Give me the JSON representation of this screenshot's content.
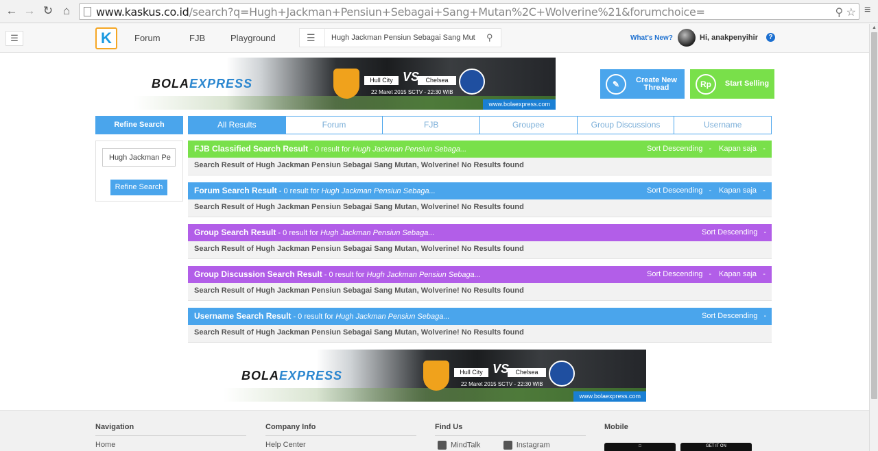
{
  "browser": {
    "url_host": "www.kaskus.co.id",
    "url_path": "/search?q=Hugh+Jackman+Pensiun+Sebagai+Sang+Mutan%2C+Wolverine%21&forumchoice="
  },
  "header": {
    "nav": [
      "Forum",
      "FJB",
      "Playground"
    ],
    "search_value": "Hugh Jackman Pensiun Sebagai Sang Mutan",
    "whats_new": "What's New?",
    "greeting": "Hi, anakpenyihir"
  },
  "banner": {
    "brand_1": "BOLA",
    "brand_2": "EXPRESS",
    "team_home": "Hull City",
    "team_away": "Chelsea",
    "vs": "VS",
    "date": "22 Maret 2015 SCTV - 22:30 WIB",
    "site": "www.bolaexpress.com"
  },
  "actions": {
    "create": "Create New Thread",
    "sell": "Start Selling",
    "sell_icon_text": "Rp"
  },
  "sidebar": {
    "title": "Refine Search",
    "input_value": "Hugh Jackman Pe",
    "button": "Refine Search"
  },
  "tabs": [
    "All Results",
    "Forum",
    "FJB",
    "Groupee",
    "Group Discussions",
    "Username"
  ],
  "sections": [
    {
      "title": "FJB Classified Search Result",
      "meta": " - 0 result for ",
      "query": "Hugh Jackman Pensiun Sebaga...",
      "sort": "Sort Descending",
      "time": "Kapan saja",
      "body": "Search Result of Hugh Jackman Pensiun Sebagai Sang Mutan, Wolverine! No Results found",
      "color": "#79e04a"
    },
    {
      "title": "Forum Search Result",
      "meta": " - 0 result for ",
      "query": "Hugh Jackman Pensiun Sebaga...",
      "sort": "Sort Descending",
      "time": "Kapan saja",
      "body": "Search Result of Hugh Jackman Pensiun Sebagai Sang Mutan, Wolverine! No Results found",
      "color": "#4aa5ec"
    },
    {
      "title": "Group Search Result",
      "meta": " - 0 result for ",
      "query": "Hugh Jackman Pensiun Sebaga...",
      "sort": "Sort Descending",
      "body": "Search Result of Hugh Jackman Pensiun Sebagai Sang Mutan, Wolverine! No Results found",
      "color": "#b25ee8"
    },
    {
      "title": "Group Discussion Search Result",
      "meta": " - 0 result for ",
      "query": "Hugh Jackman Pensiun Sebaga...",
      "sort": "Sort Descending",
      "time": "Kapan saja",
      "body": "Search Result of Hugh Jackman Pensiun Sebagai Sang Mutan, Wolverine! No Results found",
      "color": "#b25ee8"
    },
    {
      "title": "Username Search Result",
      "meta": " - 0 result for ",
      "query": "Hugh Jackman Pensiun Sebaga...",
      "sort": "Sort Descending",
      "body": "Search Result of Hugh Jackman Pensiun Sebagai Sang Mutan, Wolverine! No Results found",
      "color": "#4aa5ec"
    }
  ],
  "footer": {
    "nav_title": "Navigation",
    "nav_link": "Home",
    "company_title": "Company Info",
    "company_link": "Help Center",
    "findus_title": "Find Us",
    "findus_link_1": "MindTalk",
    "findus_link_2": "Instagram",
    "mobile_title": "Mobile",
    "store_2": "GET IT ON"
  },
  "colors": {
    "accent": "#4aa5ec",
    "green": "#79e04a",
    "purple": "#b25ee8"
  }
}
